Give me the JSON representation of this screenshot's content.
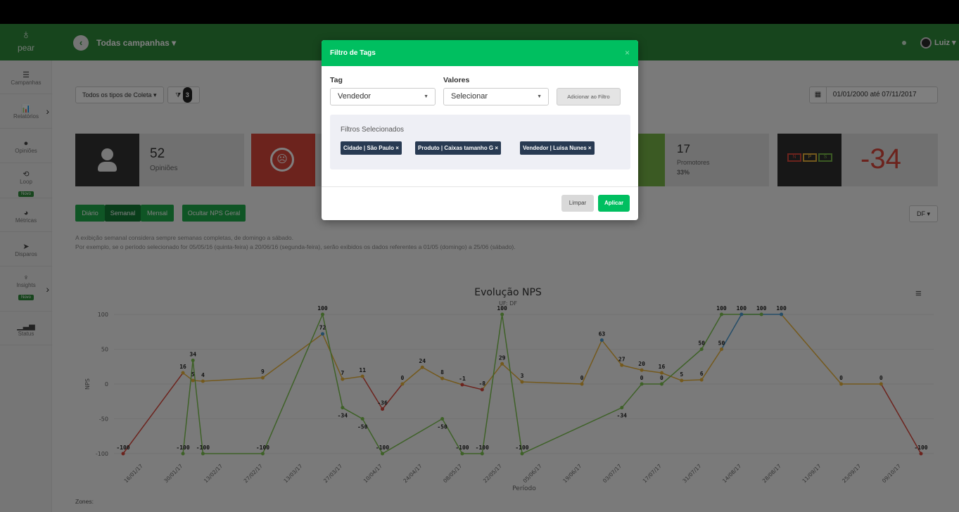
{
  "header": {
    "logo_text": "pear",
    "campaign_selector": "Todas campanhas ▾",
    "user_name": "Luiz ▾"
  },
  "sidebar": {
    "items": [
      {
        "label": "Campanhas",
        "icon": "list-icon",
        "glyph": "☰"
      },
      {
        "label": "Relatórios",
        "icon": "bar-chart-icon",
        "glyph": "📊"
      },
      {
        "label": "Opiniões",
        "icon": "chat-bubble-icon",
        "glyph": "●"
      },
      {
        "label": "Loop",
        "icon": "loop-icon",
        "glyph": "⟲",
        "badge": "Novo"
      },
      {
        "label": "Métricas",
        "icon": "dashboard-icon",
        "glyph": "◕"
      },
      {
        "label": "Disparos",
        "icon": "paper-plane-icon",
        "glyph": "➤"
      },
      {
        "label": "Insights",
        "icon": "lightbulb-icon",
        "glyph": "♀",
        "badge": "Novo"
      },
      {
        "label": "Status",
        "icon": "signal-icon",
        "glyph": "▁▃▅"
      }
    ]
  },
  "filters": {
    "collection_type": "Todos os tipos de Coleta ▾",
    "filter_count": "3",
    "date_range": "01/01/2000 até 07/11/2017",
    "region_dropdown": "DF ▾"
  },
  "cards": {
    "opinions": {
      "value": "52",
      "label": "Opiniões"
    },
    "promoters": {
      "value": "17",
      "label": "Promotores",
      "percent": "33%"
    },
    "nps": {
      "value": "-34",
      "icon_letters": [
        "N",
        "P",
        "S"
      ]
    }
  },
  "period_tabs": [
    "Diário",
    "Semanal",
    "Mensal"
  ],
  "hide_nps_button": "Ocultar NPS Geral",
  "notes": {
    "line1": "A exibição semanal considera sempre semanas completas, de domingo a sábado.",
    "line2": "Por exemplo, se o período selecionado for 05/05/16 (quinta-feira) a 20/06/16 (segunda-feira), serão exibidos os dados referentes a 01/05 (domingo) a 25/06 (sábado)."
  },
  "zones_label": "Zones:",
  "modal": {
    "title": "Filtro de Tags",
    "close": "×",
    "tag_label": "Tag",
    "tag_value": "Vendedor",
    "values_label": "Valores",
    "values_value": "Selecionar",
    "add_button": "Adicionar ao Filtro",
    "selected_title": "Filtros Selecionados",
    "chips": [
      "Cidade | São Paulo ×",
      "Produto | Caixas tamanho G ×",
      "Vendedor | Luisa Nunes ×"
    ],
    "clear_button": "Limpar",
    "apply_button": "Aplicar"
  },
  "colors": {
    "brand_green": "#2e8b3a",
    "modal_green": "#00bf60",
    "chip_navy": "#283a52",
    "detractor_red": "#d9463b",
    "promoter_green": "#77b446",
    "nps_dark": "#2f2f2f",
    "df_line": "#7cc24f",
    "geral_orange": "#e8b33a",
    "geral_blue": "#4a9bd0",
    "geral_red": "#d9463b"
  },
  "chart_data": {
    "type": "line",
    "title": "Evolução NPS",
    "subtitle": "UF: DF",
    "xlabel": "Período",
    "ylabel": "NPS",
    "ylim": [
      -100,
      100
    ],
    "yticks": [
      100,
      50,
      0,
      -50,
      -100
    ],
    "legend": "bottom",
    "x_ticks": [
      "16/01/17",
      "30/01/17",
      "13/02/17",
      "27/02/17",
      "13/03/17",
      "27/03/17",
      "10/04/17",
      "24/04/17",
      "08/05/17",
      "22/05/17",
      "05/06/17",
      "19/06/17",
      "03/07/17",
      "17/07/17",
      "31/07/17",
      "14/08/17",
      "28/08/17",
      "11/09/17",
      "25/09/17",
      "09/10/17"
    ],
    "series": [
      {
        "name": "DF",
        "points": [
          [
            1.5,
            -100
          ],
          [
            1.75,
            34
          ],
          [
            2.0,
            -100
          ],
          [
            3.5,
            -100
          ],
          [
            5.0,
            100
          ],
          [
            5.5,
            -34
          ],
          [
            6.0,
            -50
          ],
          [
            6.5,
            -100
          ],
          [
            8.0,
            -50
          ],
          [
            8.5,
            -100
          ],
          [
            9.0,
            -100
          ],
          [
            9.5,
            100
          ],
          [
            10.0,
            -100
          ],
          [
            12.5,
            -34
          ],
          [
            13.0,
            0
          ],
          [
            13.5,
            0
          ],
          [
            14.5,
            50
          ],
          [
            15.0,
            100
          ],
          [
            16.0,
            100
          ]
        ],
        "labels": [
          -100,
          34,
          -100,
          -100,
          100,
          -34,
          -50,
          -100,
          -50,
          -100,
          -100,
          100,
          -100,
          -34,
          0,
          0,
          50,
          100,
          100
        ]
      },
      {
        "name": "Geral",
        "points": [
          [
            0,
            -100
          ],
          [
            1.5,
            16
          ],
          [
            1.75,
            5
          ],
          [
            2.0,
            4
          ],
          [
            3.5,
            9
          ],
          [
            5.0,
            72
          ],
          [
            5.5,
            7
          ],
          [
            6.0,
            11
          ],
          [
            6.5,
            -36
          ],
          [
            7.0,
            0
          ],
          [
            7.5,
            24
          ],
          [
            8.0,
            8
          ],
          [
            8.5,
            -1
          ],
          [
            9.0,
            -8
          ],
          [
            9.5,
            29
          ],
          [
            10.0,
            3
          ],
          [
            11.5,
            0
          ],
          [
            12.0,
            63
          ],
          [
            12.5,
            27
          ],
          [
            13.0,
            20
          ],
          [
            13.5,
            16
          ],
          [
            14.0,
            5
          ],
          [
            14.5,
            6
          ],
          [
            15.0,
            50
          ],
          [
            15.5,
            100
          ],
          [
            16.5,
            100
          ],
          [
            18.0,
            0
          ],
          [
            19.0,
            0
          ],
          [
            20.0,
            -100
          ]
        ],
        "labels": [
          -100,
          16,
          5,
          4,
          9,
          72,
          7,
          11,
          -36,
          0,
          24,
          8,
          -1,
          -8,
          29,
          3,
          0,
          63,
          27,
          20,
          16,
          5,
          6,
          50,
          100,
          100,
          0,
          0,
          -100
        ]
      }
    ]
  }
}
